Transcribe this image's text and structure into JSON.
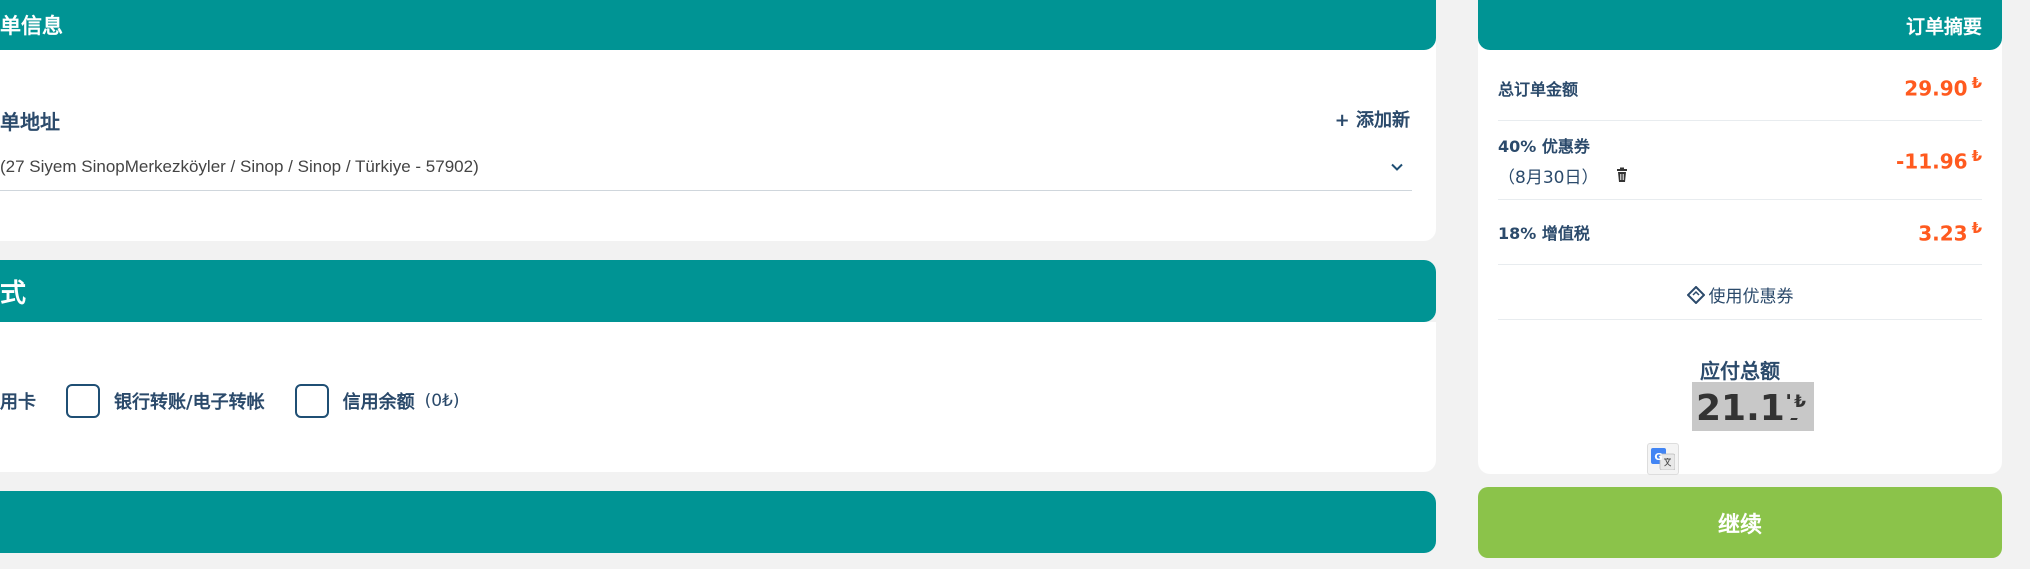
{
  "billing": {
    "section_title": "单信息",
    "address_label": "单地址",
    "add_new": "+ 添加新",
    "address_value": "(27 Siyem SinopMerkezköyler / Sinop / Sinop / Türkiye - 57902)"
  },
  "payment": {
    "section_title": "式",
    "options": [
      {
        "label": "用卡",
        "note": ""
      },
      {
        "label": "银行转账/电子转帐",
        "note": ""
      },
      {
        "label": "信用余额",
        "note": "(0₺)"
      }
    ]
  },
  "summary": {
    "title": "订单摘要",
    "total_label": "总订单金额",
    "total_value": "29.90",
    "coupon_label": "40% 优惠券",
    "coupon_date": "（8月30日）",
    "coupon_value": "-11.96",
    "vat_label": "18% 增值税",
    "vat_value": "3.23",
    "currency": "₺",
    "use_coupon": "使用优惠券",
    "payable_label": "应付总额",
    "payable_value": "21.17"
  },
  "actions": {
    "continue": "继续"
  },
  "colors": {
    "teal": "#009494",
    "orange": "#ff5a1f",
    "green": "#8bc34a",
    "navy": "#2b4a6b"
  }
}
